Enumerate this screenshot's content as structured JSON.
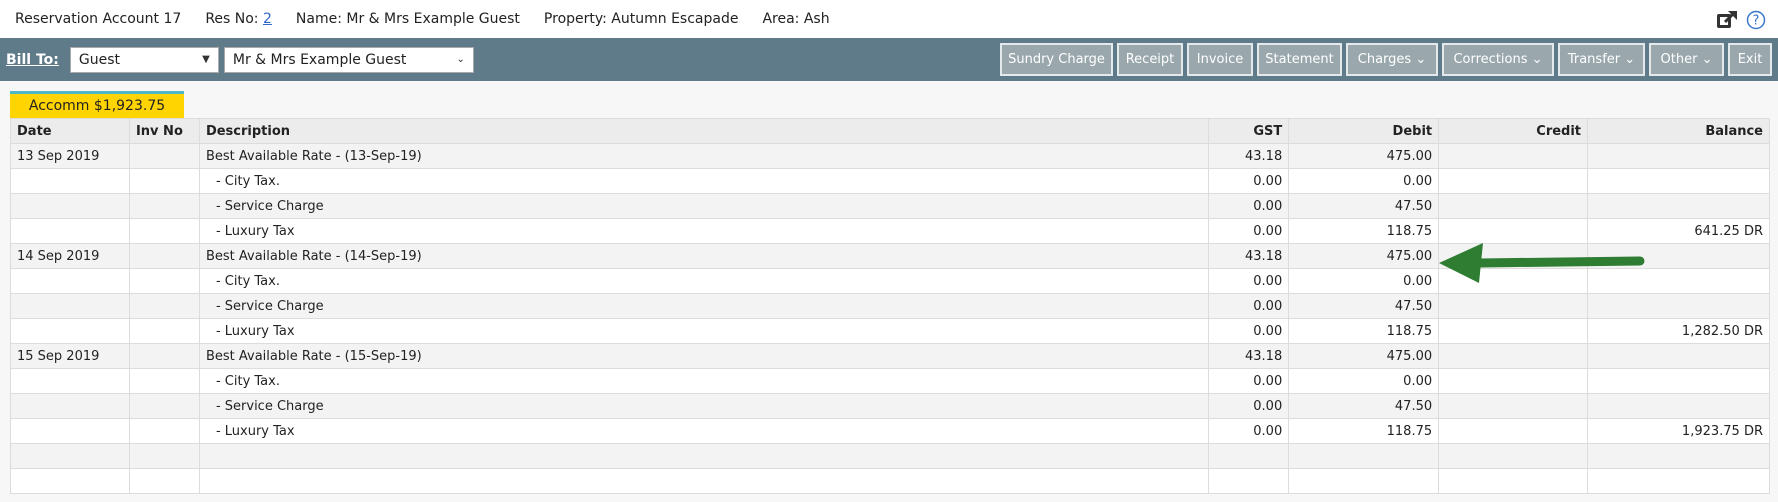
{
  "header": {
    "reservation_account": "Reservation Account 17",
    "res_no_label": "Res No:",
    "res_no_value": "2",
    "name": "Name: Mr & Mrs Example Guest",
    "property": "Property: Autumn Escapade",
    "area": "Area: Ash"
  },
  "toolbar": {
    "bill_to_label": "Bill To:",
    "bill_to_type": "Guest",
    "bill_to_name": "Mr & Mrs Example Guest",
    "buttons": {
      "sundry": "Sundry Charge",
      "receipt": "Receipt",
      "invoice": "Invoice",
      "statement": "Statement",
      "charges": "Charges",
      "corrections": "Corrections",
      "transfer": "Transfer",
      "other": "Other",
      "exit": "Exit"
    }
  },
  "tab": {
    "label": "Accomm $1,923.75"
  },
  "table": {
    "headers": [
      "Date",
      "Inv No",
      "Description",
      "GST",
      "Debit",
      "Credit",
      "Balance"
    ],
    "rows": [
      [
        "13 Sep 2019",
        "",
        "Best Available Rate - (13-Sep-19)",
        "43.18",
        "475.00",
        "",
        ""
      ],
      [
        "",
        "",
        "- City Tax.",
        "0.00",
        "0.00",
        "",
        ""
      ],
      [
        "",
        "",
        "- Service Charge",
        "0.00",
        "47.50",
        "",
        ""
      ],
      [
        "",
        "",
        "- Luxury Tax",
        "0.00",
        "118.75",
        "",
        "641.25 DR"
      ],
      [
        "14 Sep 2019",
        "",
        "Best Available Rate - (14-Sep-19)",
        "43.18",
        "475.00",
        "",
        ""
      ],
      [
        "",
        "",
        "- City Tax.",
        "0.00",
        "0.00",
        "",
        ""
      ],
      [
        "",
        "",
        "- Service Charge",
        "0.00",
        "47.50",
        "",
        ""
      ],
      [
        "",
        "",
        "- Luxury Tax",
        "0.00",
        "118.75",
        "",
        "1,282.50 DR"
      ],
      [
        "15 Sep 2019",
        "",
        "Best Available Rate - (15-Sep-19)",
        "43.18",
        "475.00",
        "",
        ""
      ],
      [
        "",
        "",
        "- City Tax.",
        "0.00",
        "0.00",
        "",
        ""
      ],
      [
        "",
        "",
        "- Service Charge",
        "0.00",
        "47.50",
        "",
        ""
      ],
      [
        "",
        "",
        "- Luxury Tax",
        "0.00",
        "118.75",
        "",
        "1,923.75 DR"
      ],
      [
        "",
        "",
        "",
        "",
        "",
        "",
        ""
      ],
      [
        "",
        "",
        "",
        "",
        "",
        "",
        ""
      ]
    ]
  },
  "icons": {
    "external": "external-link-icon",
    "help": "help-icon"
  },
  "colors": {
    "toolbar": "#5f7b89",
    "tab": "#ffd400",
    "arrow": "#2e7d32"
  }
}
